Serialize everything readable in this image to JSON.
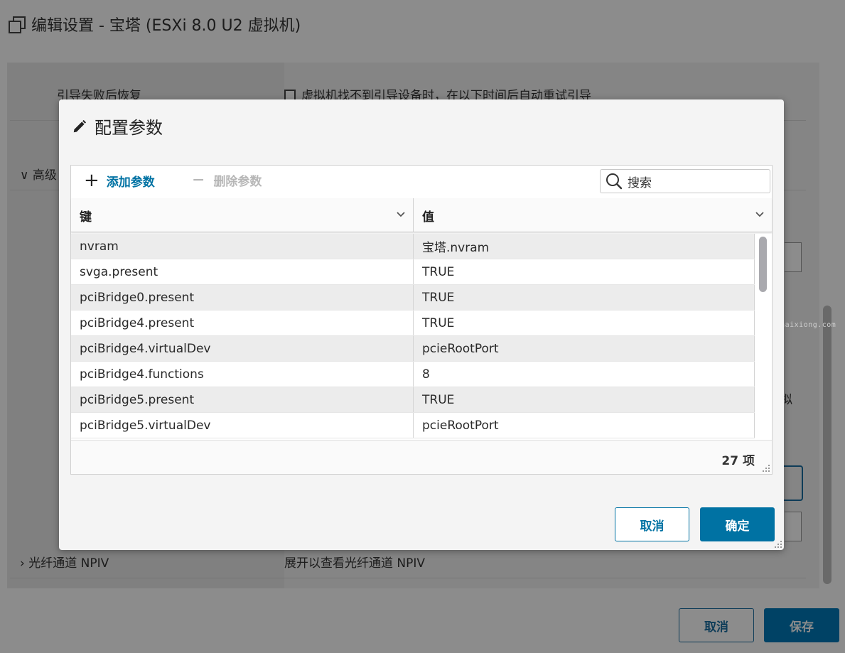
{
  "background": {
    "title": "编辑设置 - 宝塔 (ESXi 8.0 U2 虚拟机)",
    "rows": [
      {
        "label": "引导失败后恢复",
        "value": "虚拟机找不到引导设备时，在以下时间后自动重试引导"
      },
      {
        "label": "高级",
        "value": ""
      },
      {
        "label": "光纤通道 NPIV",
        "value": "展开以查看光纤通道 NPIV"
      }
    ],
    "side_text": "拟",
    "cancel_label": "取消",
    "save_label": "保存",
    "watermark": "Yanghaixiong.com"
  },
  "modal": {
    "title": "配置参数",
    "toolbar": {
      "add_label": "添加参数",
      "delete_label": "删除参数",
      "search_placeholder": "搜索"
    },
    "columns": {
      "key": "键",
      "value": "值"
    },
    "rows": [
      {
        "key": "nvram",
        "value": "宝塔.nvram"
      },
      {
        "key": "svga.present",
        "value": "TRUE"
      },
      {
        "key": "pciBridge0.present",
        "value": "TRUE"
      },
      {
        "key": "pciBridge4.present",
        "value": "TRUE"
      },
      {
        "key": "pciBridge4.virtualDev",
        "value": "pcieRootPort"
      },
      {
        "key": "pciBridge4.functions",
        "value": "8"
      },
      {
        "key": "pciBridge5.present",
        "value": "TRUE"
      },
      {
        "key": "pciBridge5.virtualDev",
        "value": "pcieRootPort"
      }
    ],
    "item_count": "27 项",
    "cancel_label": "取消",
    "ok_label": "确定"
  },
  "colors": {
    "accent": "#0072a3",
    "overlay": "rgba(0,0,0,0.45)"
  }
}
